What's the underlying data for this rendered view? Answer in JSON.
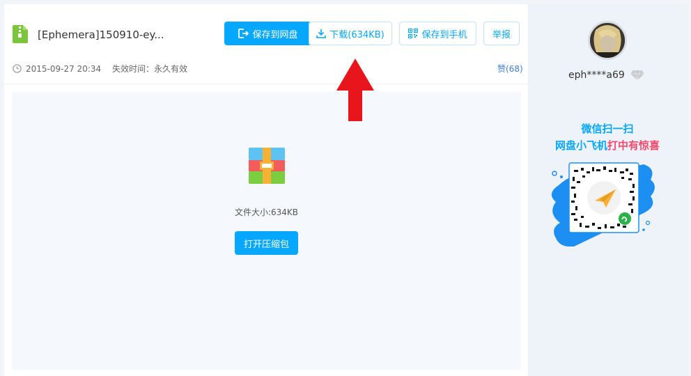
{
  "file": {
    "name": "[Ephemera]150910-ey...",
    "date": "2015-09-27 20:34",
    "expire": "失效时间：永久有效",
    "like": "赞(68)",
    "size_text": "文件大小:634KB"
  },
  "toolbar": {
    "save_label": "保存到网盘",
    "download_label": "下载(634KB)",
    "save_phone_label": "保存到手机",
    "report_label": "举报"
  },
  "preview": {
    "open_label": "打开压缩包"
  },
  "user": {
    "name": "eph****a69"
  },
  "promo": {
    "line1": "微信扫一扫",
    "line2_a": "网盘小飞机",
    "line2_b": "打中有惊喜"
  },
  "colors": {
    "accent": "#06a7ff",
    "promo_red": "#f7476a",
    "annotation_arrow": "#e8161c"
  }
}
